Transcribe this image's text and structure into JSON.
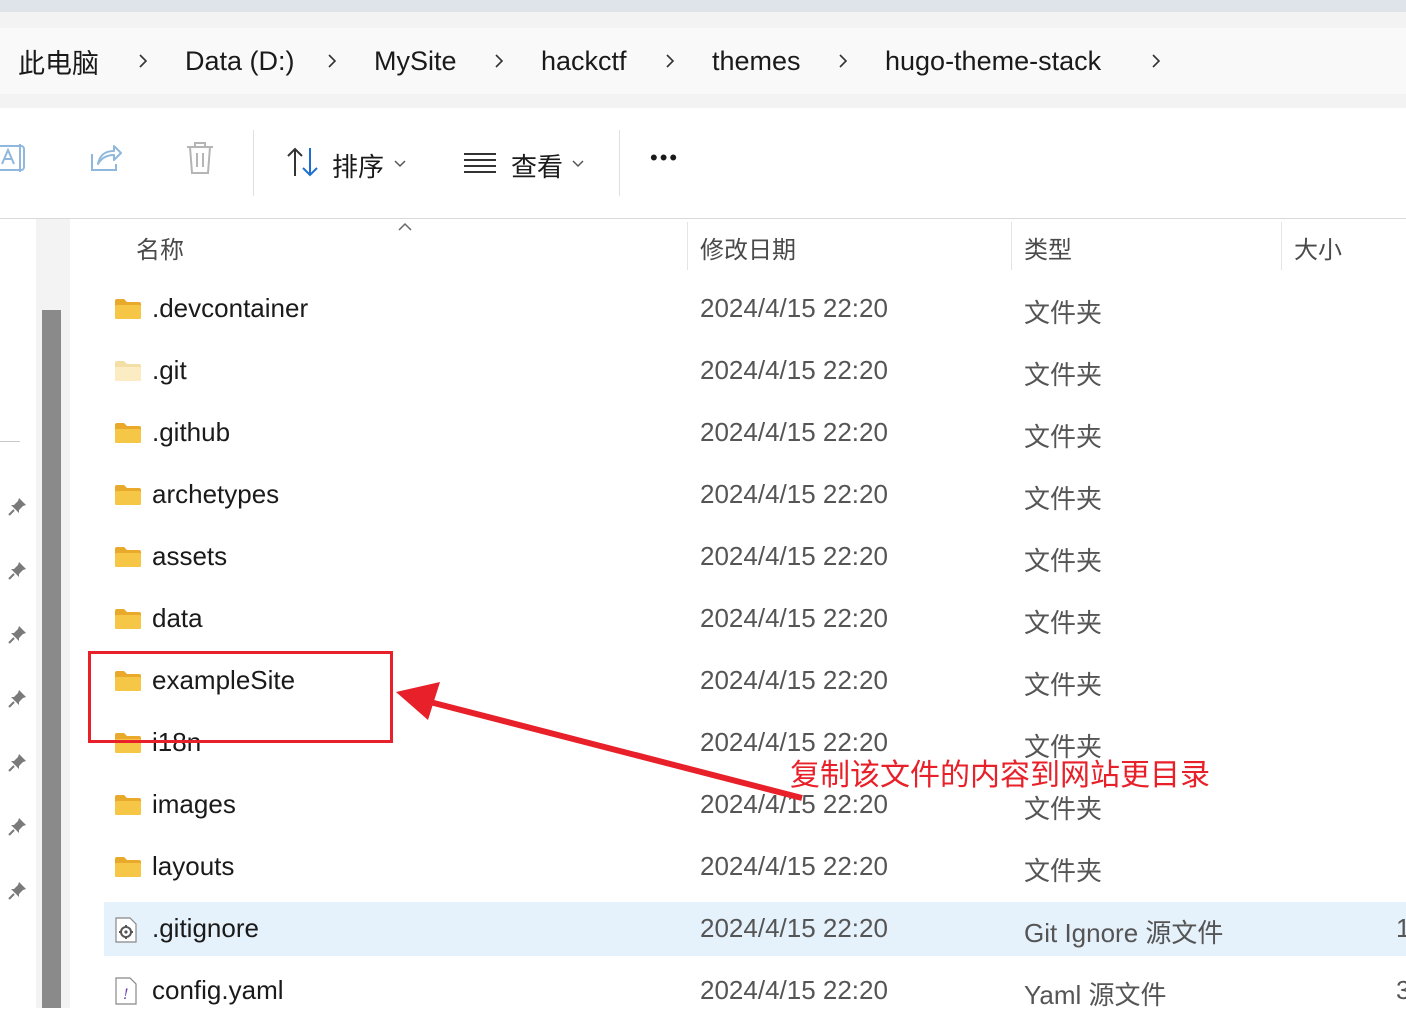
{
  "breadcrumb": {
    "items": [
      "此电脑",
      "Data (D:)",
      "MySite",
      "hackctf",
      "themes",
      "hugo-theme-stack"
    ]
  },
  "toolbar": {
    "sort_label": "排序",
    "view_label": "查看",
    "more_label": "•••"
  },
  "columns": {
    "name": "名称",
    "date": "修改日期",
    "type": "类型",
    "size": "大小"
  },
  "files": [
    {
      "name": ".devcontainer",
      "date": "2024/4/15 22:20",
      "type": "文件夹",
      "size": "",
      "icon": "folder-icon"
    },
    {
      "name": ".git",
      "date": "2024/4/15 22:20",
      "type": "文件夹",
      "size": "",
      "icon": "folder-hidden-icon"
    },
    {
      "name": ".github",
      "date": "2024/4/15 22:20",
      "type": "文件夹",
      "size": "",
      "icon": "folder-icon"
    },
    {
      "name": "archetypes",
      "date": "2024/4/15 22:20",
      "type": "文件夹",
      "size": "",
      "icon": "folder-icon"
    },
    {
      "name": "assets",
      "date": "2024/4/15 22:20",
      "type": "文件夹",
      "size": "",
      "icon": "folder-icon"
    },
    {
      "name": "data",
      "date": "2024/4/15 22:20",
      "type": "文件夹",
      "size": "",
      "icon": "folder-icon"
    },
    {
      "name": "exampleSite",
      "date": "2024/4/15 22:20",
      "type": "文件夹",
      "size": "",
      "icon": "folder-icon"
    },
    {
      "name": "i18n",
      "date": "2024/4/15 22:20",
      "type": "文件夹",
      "size": "",
      "icon": "folder-icon"
    },
    {
      "name": "images",
      "date": "2024/4/15 22:20",
      "type": "文件夹",
      "size": "",
      "icon": "folder-icon"
    },
    {
      "name": "layouts",
      "date": "2024/4/15 22:20",
      "type": "文件夹",
      "size": "",
      "icon": "folder-icon"
    },
    {
      "name": ".gitignore",
      "date": "2024/4/15 22:20",
      "type": "Git Ignore 源文件",
      "size": "1",
      "icon": "settings-file-icon"
    },
    {
      "name": "config.yaml",
      "date": "2024/4/15 22:20",
      "type": "Yaml 源文件",
      "size": "3",
      "icon": "yaml-file-icon"
    }
  ],
  "annotation": {
    "text": "复制该文件的内容到网站更目录",
    "color": "#e8202a"
  },
  "colors": {
    "folder": "#f6c646",
    "selected_row": "#e5f1fb",
    "annotation": "#e8202a"
  }
}
